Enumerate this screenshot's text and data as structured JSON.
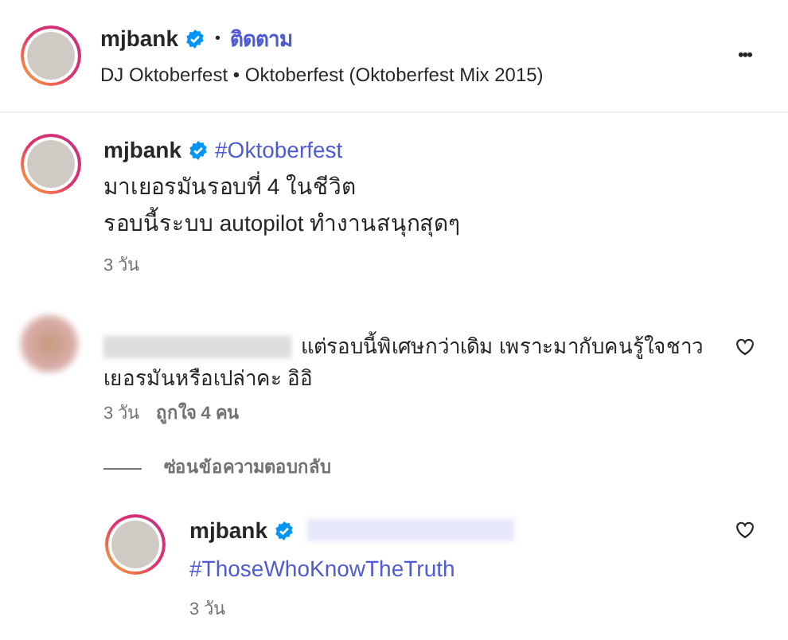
{
  "header": {
    "username": "mjbank",
    "verified": true,
    "separator": "•",
    "follow": "ติดตาม",
    "subtitle": "DJ Oktoberfest • Oktoberfest (Oktoberfest Mix 2015)",
    "more": "•••"
  },
  "caption": {
    "username": "mjbank",
    "verified": true,
    "hashtag": "#Oktoberfest",
    "lines": [
      "มาเยอรมันรอบที่ 4 ในชีวิต",
      "รอบนี้ระบบ autopilot ทำงานสนุกสุดๆ"
    ],
    "time": "3 วัน"
  },
  "comment": {
    "name_blurred": true,
    "text": "แต่รอบนี้พิเศษกว่าเดิม เพราะมากับคนรู้ใจชาว เยอรมันหรือเปล่าคะ อิอิ",
    "time": "3 วัน",
    "likes": "ถูกใจ 4 คน",
    "liked": false
  },
  "hide_replies": "ซ่อนข้อความตอบกลับ",
  "reply": {
    "username": "mjbank",
    "verified": true,
    "mention_blurred": true,
    "hashtag": "#ThoseWhoKnowTheTruth",
    "time": "3 วัน",
    "liked": false
  }
}
